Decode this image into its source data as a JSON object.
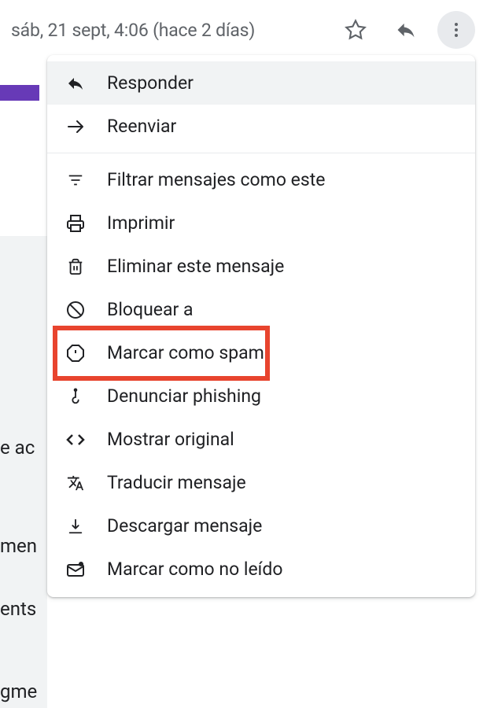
{
  "header": {
    "timestamp": "sáb, 21 sept, 4:06 (hace 2 días)"
  },
  "menu": {
    "reply": "Responder",
    "forward": "Reenviar",
    "filter": "Filtrar mensajes como este",
    "print": "Imprimir",
    "delete": "Eliminar este mensaje",
    "block": "Bloquear a",
    "spam": "Marcar como spam",
    "phishing": "Denunciar phishing",
    "original": "Mostrar original",
    "translate": "Traducir mensaje",
    "download": "Descargar mensaje",
    "unread": "Marcar como no leído"
  },
  "fragments": {
    "f1": "e ac",
    "f2": "men",
    "f3": "ents",
    "f4": "gme"
  }
}
